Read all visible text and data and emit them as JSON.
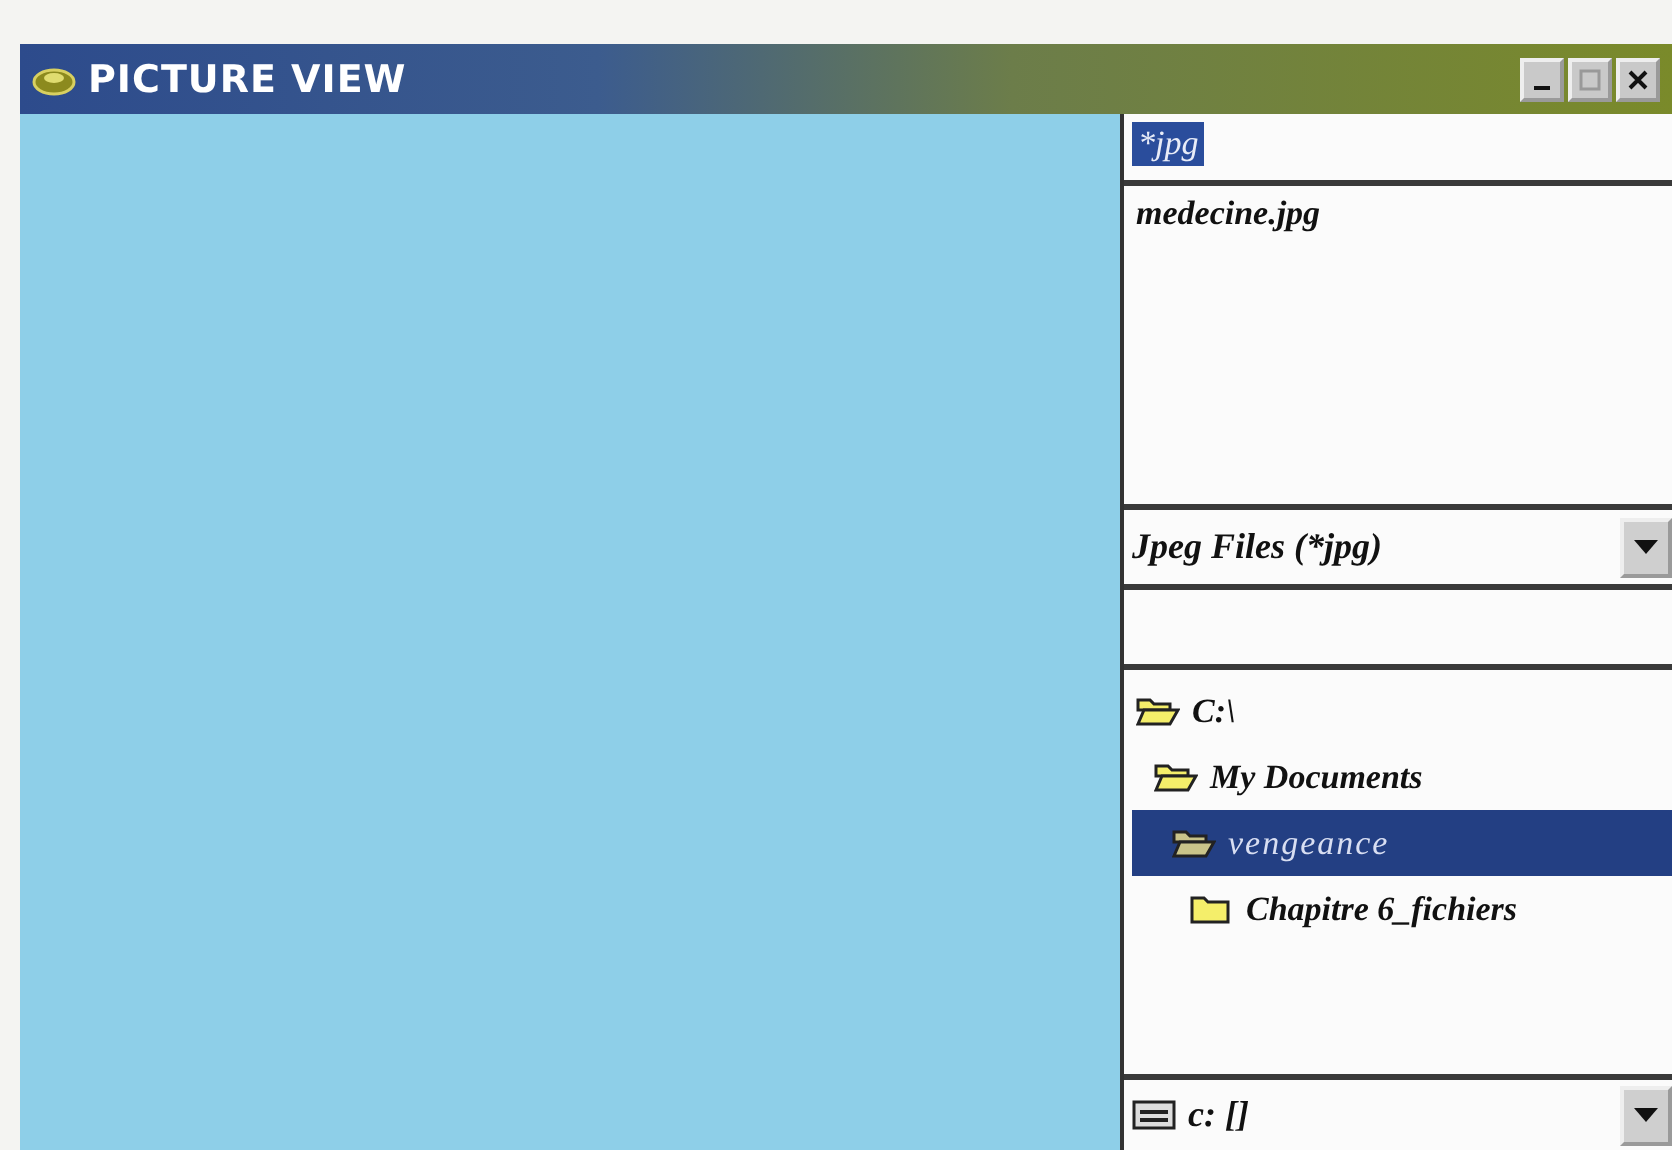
{
  "window": {
    "title": "PICTURE VIEW"
  },
  "filter_field": {
    "value": "*jpg",
    "selected": true
  },
  "file_list": {
    "items": [
      {
        "label": "medecine.jpg",
        "selected": false
      }
    ]
  },
  "file_type": {
    "value": "Jpeg Files (*jpg)"
  },
  "folders": [
    {
      "label": "C:\\",
      "expanded": true,
      "selected": false,
      "children": [
        {
          "label": "My Documents",
          "expanded": true,
          "selected": false,
          "children": [
            {
              "label": "vengeance",
              "expanded": true,
              "selected": true,
              "children": [
                {
                  "label": "Chapitre 6_fichiers",
                  "expanded": false,
                  "selected": false
                }
              ]
            }
          ]
        }
      ]
    }
  ],
  "drive": {
    "value": "c: []"
  }
}
